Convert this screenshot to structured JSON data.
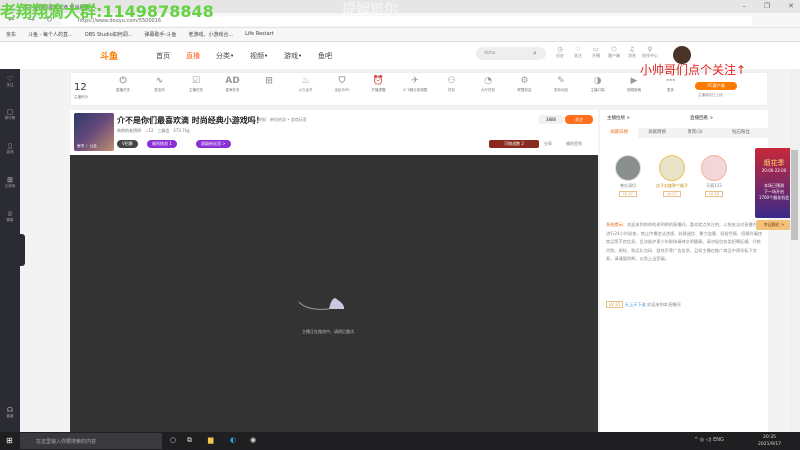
{
  "browser": {
    "tab_title": "介不是你们最喜欢滴 时尚经典小...",
    "url": "https://www.douyu.com/5500016",
    "bookmarks": [
      "京东",
      "斗鱼 - 每个人的直...",
      "OBS Studio如何调...",
      "弹幕助手-斗鱼",
      "老游戏、小游戏合...",
      "Life Restart"
    ]
  },
  "overlay": {
    "watermark_group": "老翔翔滴大群:1149878848",
    "watermark_name": "提姆塔尔",
    "follow_hint": "小帅哥们点个关注↑"
  },
  "header": {
    "logo": "斗鱼",
    "nav": [
      "首页",
      "直播",
      "分类•",
      "视频•",
      "游戏•",
      "鱼吧"
    ],
    "search_value": "dota",
    "icons": [
      {
        "label": "历史",
        "glyph": "◷"
      },
      {
        "label": "关注",
        "glyph": "♡"
      },
      {
        "label": "开播",
        "glyph": "▭"
      },
      {
        "label": "客户端",
        "glyph": "⬡"
      },
      {
        "label": "消息",
        "glyph": "♫"
      },
      {
        "label": "创作中心",
        "glyph": "♀"
      }
    ]
  },
  "sidebar": [
    {
      "label": "关注",
      "glyph": "♡"
    },
    {
      "label": "排行榜",
      "glyph": "▢"
    },
    {
      "label": "游戏",
      "glyph": "▯"
    },
    {
      "label": "云游戏",
      "glyph": "⊞"
    },
    {
      "label": "赛事",
      "glyph": "♕"
    },
    {
      "label": "客服",
      "glyph": "☊"
    }
  ],
  "toolbar": {
    "score": "12",
    "score_label": "主播积分",
    "pc_button": "PC客户端",
    "pc_caption": "主播端也已上线",
    "tools": [
      {
        "label": "直播开关",
        "glyph": "⏻"
      },
      {
        "label": "麦克风",
        "glyph": "∿"
      },
      {
        "label": "主播任务",
        "glyph": "☑"
      },
      {
        "label": "星海任务",
        "glyph": "AD"
      },
      {
        "label": "",
        "glyph": "⊞"
      },
      {
        "label": "火力全开",
        "glyph": "♨"
      },
      {
        "label": "全民乐PK",
        "glyph": "⛉"
      },
      {
        "label": "开播提醒",
        "glyph": "⏰"
      },
      {
        "label": "小飞碟分成调整",
        "glyph": "✈"
      },
      {
        "label": "好友",
        "glyph": "⚇"
      },
      {
        "label": "大厅任务",
        "glyph": "◔"
      },
      {
        "label": "联盟权益",
        "glyph": "⚙"
      },
      {
        "label": "发布动态",
        "glyph": "✎"
      },
      {
        "label": "主播口袋",
        "glyph": "◑"
      },
      {
        "label": "视频投稿",
        "glyph": "▶"
      },
      {
        "label": "更多",
        "glyph": "⋯"
      }
    ]
  },
  "room": {
    "title": "介不是你们最喜欢滴 时尚经典小游戏吗！",
    "report": "举报",
    "category": "单机热游 • 游戏玩家",
    "streamer": "帅帅的老明明",
    "hot": "12",
    "level": "三级会",
    "weight": "373.7kg",
    "cover_label": "鱼吧 丨 公告",
    "pills": [
      "V招募",
      "福利挑战 1",
      "超级粉丝团 >"
    ],
    "follow_count": "3886",
    "follow_button": "关注",
    "gift_badge": "可挑战数 2",
    "share": "分享",
    "client": "福利签到"
  },
  "video": {
    "status": "主播正在路途中，请稍后重试"
  },
  "right_panel": {
    "top_links": [
      "主播拉榜 >",
      "直播回看 >"
    ],
    "tabs": [
      "贡献日榜",
      "贡献周榜",
      "贵宾(3)",
      "钻石粉丝"
    ],
    "ranks": [
      {
        "name": "善在清切",
        "level": "LV 17"
      },
      {
        "name": "庄子右旋钟个猴子",
        "level": "LV 27"
      },
      {
        "name": "天痕123",
        "level": "LV 16"
      }
    ],
    "system_label": "系统提示：",
    "system_text": "欢迎来到帅帅的老明明的直播间，喜欢就点关注吧。斗鱼依法对直播内容进行24小时巡查，禁止传播违法违规、封建迷信、暴力血腥、低俗色情、招嫖诈骗违禁品等不良信息，坚决维护青少年群体精神文明健康。请勿轻信各类招聘征婚、代练代购、刷钻、购买礼包码、游戏币等广告信息，且如主播在推广商品中诱导私下交易，请谨慎判断，以免上当受骗。",
    "chat": {
      "level": "LV 21",
      "user": "天上天下谁",
      "text": "欢迎来到本直播间"
    },
    "ad": {
      "title": "烟花季",
      "time": "20:00-22:00",
      "line1": "本场已预测",
      "line2": "下一场开启",
      "line3": "1700个烟花机会",
      "button": "幸运翻花 >"
    }
  },
  "taskbar": {
    "search_placeholder": "在这里输入你要搜索的内容",
    "lang": "ENG",
    "time": "20:35",
    "date": "2021/9/17"
  },
  "colors": {
    "accent": "#ff7a00",
    "follow": "#ff6f1e",
    "hint": "#e0241b",
    "watermark": "#5fd13a"
  }
}
